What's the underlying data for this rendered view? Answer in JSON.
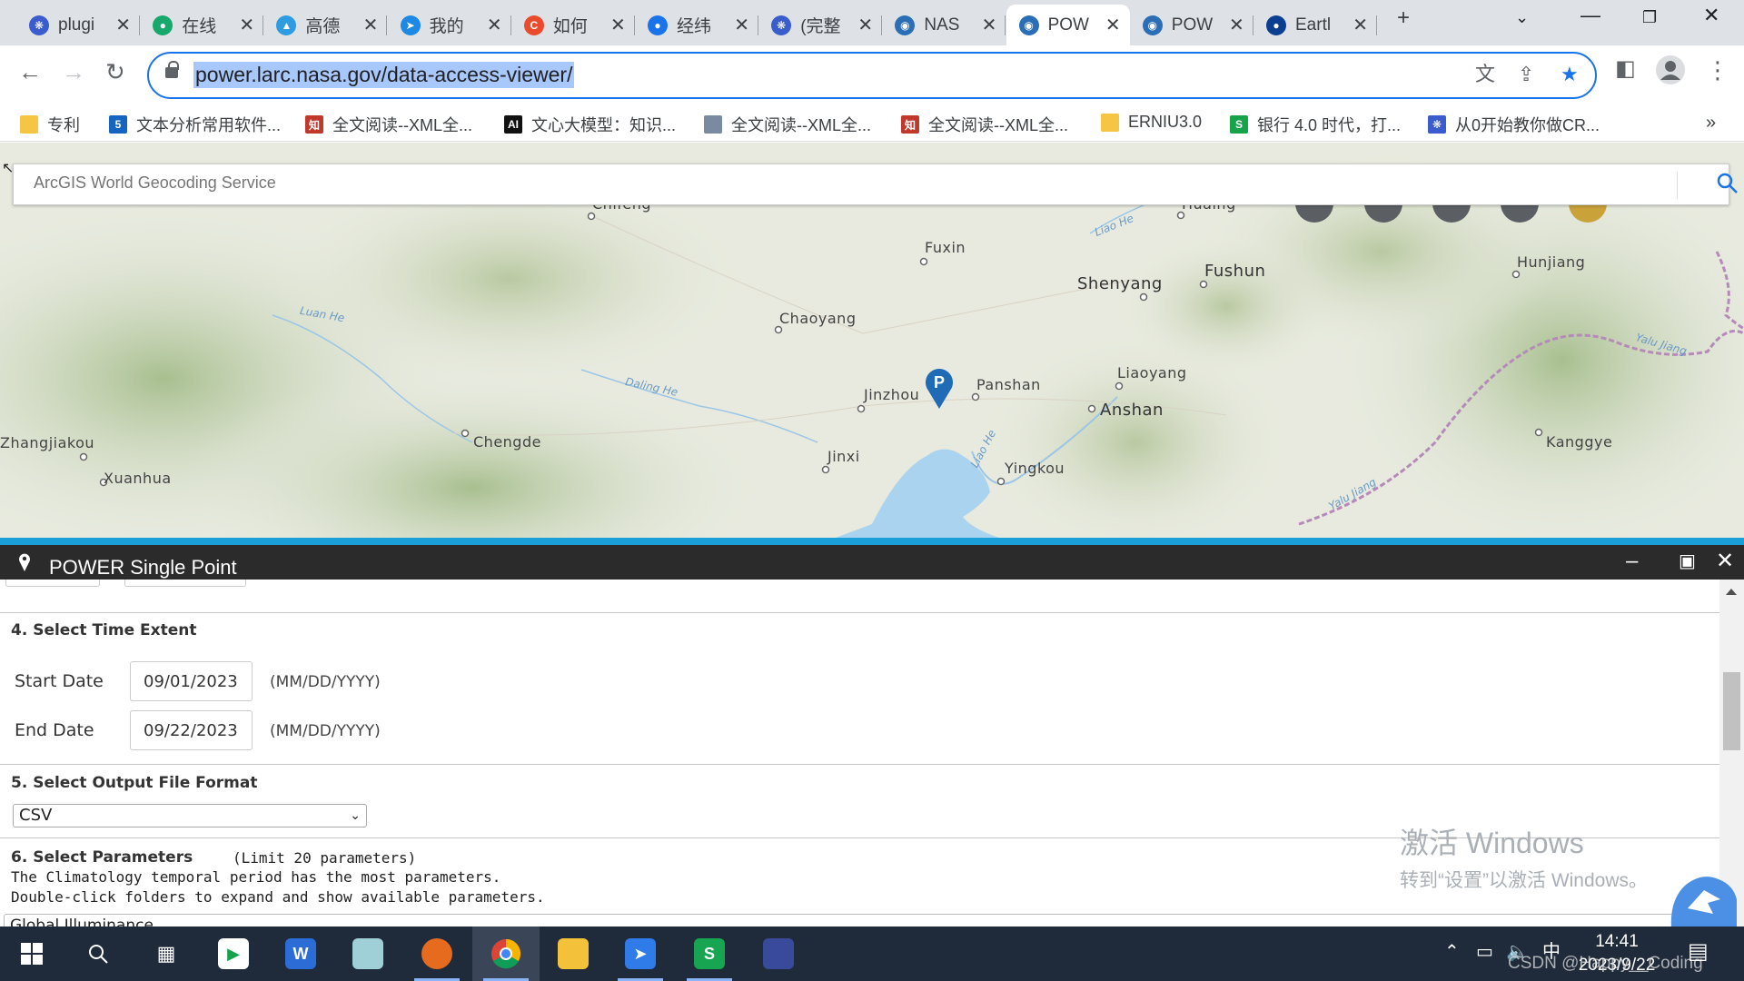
{
  "browser": {
    "tabs": [
      {
        "title": "plugi",
        "icon": "baidu-paw-icon",
        "color": "#3a5ccc"
      },
      {
        "title": "在线",
        "icon": "globe-icon",
        "color": "#17a86b"
      },
      {
        "title": "高德",
        "icon": "amap-icon",
        "color": "#2f9be0"
      },
      {
        "title": "我的",
        "icon": "paper-plane-icon",
        "color": "#1e88e5"
      },
      {
        "title": "如何",
        "icon": "csdn-icon",
        "color": "#e94b2c"
      },
      {
        "title": "经纬",
        "icon": "globe-icon",
        "color": "#1a73e8"
      },
      {
        "title": "(完整",
        "icon": "baidu-paw-icon",
        "color": "#3a5ccc"
      },
      {
        "title": "NAS",
        "icon": "power-globe-icon",
        "color": "#2a6fb5"
      },
      {
        "title": "POW",
        "icon": "power-globe-icon",
        "color": "#2a6fb5",
        "active": true
      },
      {
        "title": "POW",
        "icon": "power-globe-icon",
        "color": "#2a6fb5"
      },
      {
        "title": "Eartl",
        "icon": "nasa-meatball-icon",
        "color": "#0b3d91"
      }
    ],
    "url": "power.larc.nasa.gov/data-access-viewer/",
    "bookmarks": [
      {
        "label": "专利",
        "icon": "folder-icon",
        "color": "#f6c543"
      },
      {
        "label": "文本分析常用软件...",
        "icon": "five-icon",
        "color": "#1565c0"
      },
      {
        "label": "全文阅读--XML全...",
        "icon": "cnki-icon",
        "color": "#c0392b"
      },
      {
        "label": "文心大模型：知识...",
        "icon": "ai-icon",
        "color": "#111111"
      },
      {
        "label": "全文阅读--XML全...",
        "icon": "doc-icon",
        "color": "#7a8aa0"
      },
      {
        "label": "全文阅读--XML全...",
        "icon": "cnki-icon",
        "color": "#c0392b"
      },
      {
        "label": "ERNIU3.0",
        "icon": "folder-icon",
        "color": "#f6c543"
      },
      {
        "label": "银行 4.0 时代，打...",
        "icon": "green-s-icon",
        "color": "#16a34a"
      },
      {
        "label": "从0开始教你做CR...",
        "icon": "baidu-paw-icon",
        "color": "#3a5ccc"
      }
    ],
    "more_bookmarks": "»"
  },
  "map": {
    "search_placeholder": "ArcGIS World Geocoding Service",
    "cities": [
      {
        "name": "Chifeng"
      },
      {
        "name": "Fuxin"
      },
      {
        "name": "Shenyang"
      },
      {
        "name": "Fushun"
      },
      {
        "name": "Hunjiang"
      },
      {
        "name": "Chaoyang"
      },
      {
        "name": "Jinzhou"
      },
      {
        "name": "Panshan"
      },
      {
        "name": "Liaoyang"
      },
      {
        "name": "Anshan"
      },
      {
        "name": "Zhangjiakou"
      },
      {
        "name": "Chengde"
      },
      {
        "name": "Xuanhua"
      },
      {
        "name": "Jinxi"
      },
      {
        "name": "Yingkou"
      },
      {
        "name": "Kanggye"
      },
      {
        "name": "Huaing"
      }
    ],
    "rivers": [
      "Liao He",
      "Luan He",
      "Daling He",
      "Liao He",
      "Yalu Jiang",
      "Yalu Jiang"
    ],
    "marker_label": "P",
    "marker_color": "#1f6bb5"
  },
  "panel": {
    "title": "POWER Single Point",
    "time_extent": {
      "heading": "4. Select Time Extent",
      "start_label": "Start Date",
      "start_value": "09/01/2023",
      "end_label": "End Date",
      "end_value": "09/22/2023",
      "format_hint": "(MM/DD/YYYY)"
    },
    "output_format": {
      "heading": "5. Select Output File Format",
      "selected": "CSV"
    },
    "parameters": {
      "heading": "6. Select Parameters",
      "limit": "(Limit 20 parameters)",
      "line1": "The Climatology temporal period has the most parameters.",
      "line2": "Double-click folders to expand and show available parameters.",
      "first_folder": "Global Illuminance"
    }
  },
  "watermark": {
    "line1": "激活 Windows",
    "line2": "转到“设置”以激活 Windows。"
  },
  "taskbar": {
    "time": "14:41",
    "date": "2023/9/22",
    "ime": "中",
    "csdn": "CSDN @Happy__Coding"
  },
  "colors": {
    "accent": "#1a9fd9",
    "panel_header": "#2b2b2b",
    "omnibox_focus": "#1a73e8",
    "taskbar": "#1f2a3a"
  }
}
